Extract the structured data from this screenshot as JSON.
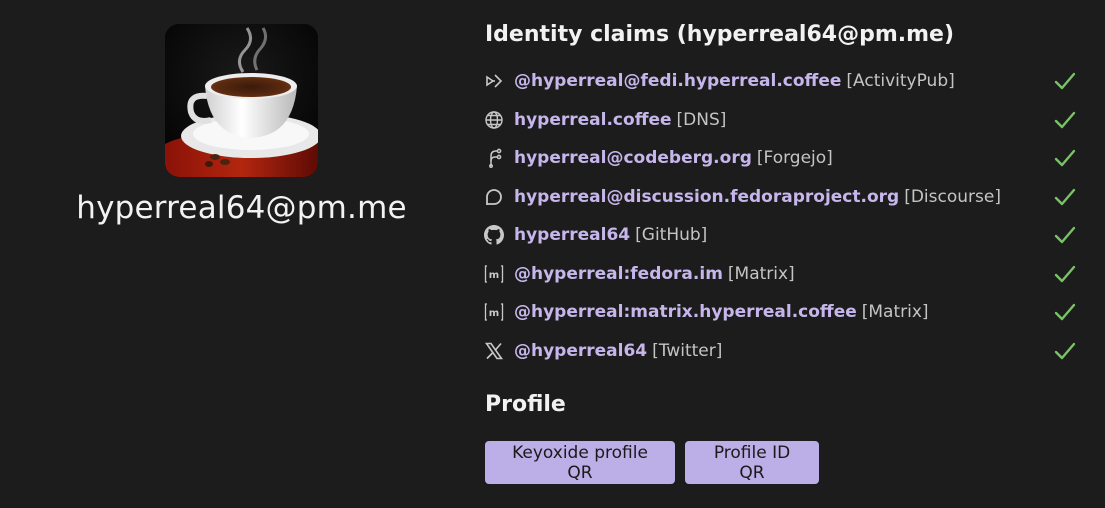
{
  "profile": {
    "name": "hyperreal64@pm.me",
    "avatar_icon": "coffee-cup-image"
  },
  "claims_section": {
    "heading": "Identity claims (hyperreal64@pm.me)",
    "items": [
      {
        "icon": "activitypub-icon",
        "id": "@hyperreal@fedi.hyperreal.coffee",
        "type": "[ActivityPub]",
        "verified": true
      },
      {
        "icon": "globe-icon",
        "id": "hyperreal.coffee",
        "type": "[DNS]",
        "verified": true
      },
      {
        "icon": "forgejo-icon",
        "id": "hyperreal@codeberg.org",
        "type": "[Forgejo]",
        "verified": true
      },
      {
        "icon": "discourse-icon",
        "id": "hyperreal@discussion.fedoraproject.org",
        "type": "[Discourse]",
        "verified": true
      },
      {
        "icon": "github-icon",
        "id": "hyperreal64",
        "type": "[GitHub]",
        "verified": true
      },
      {
        "icon": "matrix-icon",
        "id": "@hyperreal:fedora.im",
        "type": "[Matrix]",
        "verified": true
      },
      {
        "icon": "matrix-icon",
        "id": "@hyperreal:matrix.hyperreal.coffee",
        "type": "[Matrix]",
        "verified": true
      },
      {
        "icon": "x-twitter-icon",
        "id": "@hyperreal64",
        "type": "[Twitter]",
        "verified": true
      }
    ]
  },
  "profile_section": {
    "heading": "Profile",
    "buttons": {
      "keyoxide_qr": "Keyoxide profile QR",
      "profile_id_qr": "Profile ID QR"
    }
  },
  "colors": {
    "background": "#1c1c1c",
    "link": "#c6b6ec",
    "button": "#bcaee6",
    "check": "#79c267"
  }
}
